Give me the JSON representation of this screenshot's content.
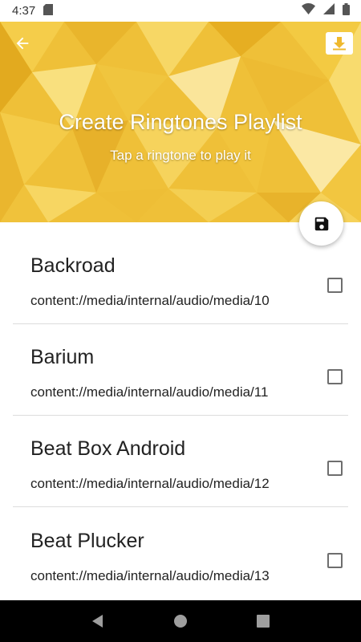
{
  "status_bar": {
    "time": "4:37",
    "icons": [
      "sd-card-icon",
      "wifi-icon",
      "cell-signal-icon",
      "battery-icon"
    ]
  },
  "header": {
    "title": "Create Ringtones Playlist",
    "subtitle": "Tap a ringtone to play it",
    "back_icon": "arrow-back-icon",
    "download_icon": "download-icon",
    "save_icon": "save-icon",
    "accent_color": "#F2C12E"
  },
  "ringtones": [
    {
      "name": "Backroad",
      "path": "content://media/internal/audio/media/10",
      "checked": false
    },
    {
      "name": "Barium",
      "path": "content://media/internal/audio/media/11",
      "checked": false
    },
    {
      "name": "Beat Box Android",
      "path": "content://media/internal/audio/media/12",
      "checked": false
    },
    {
      "name": "Beat Plucker",
      "path": "content://media/internal/audio/media/13",
      "checked": false
    }
  ],
  "nav_bar": {
    "icons": [
      "back-triangle-icon",
      "home-circle-icon",
      "recents-square-icon"
    ]
  }
}
